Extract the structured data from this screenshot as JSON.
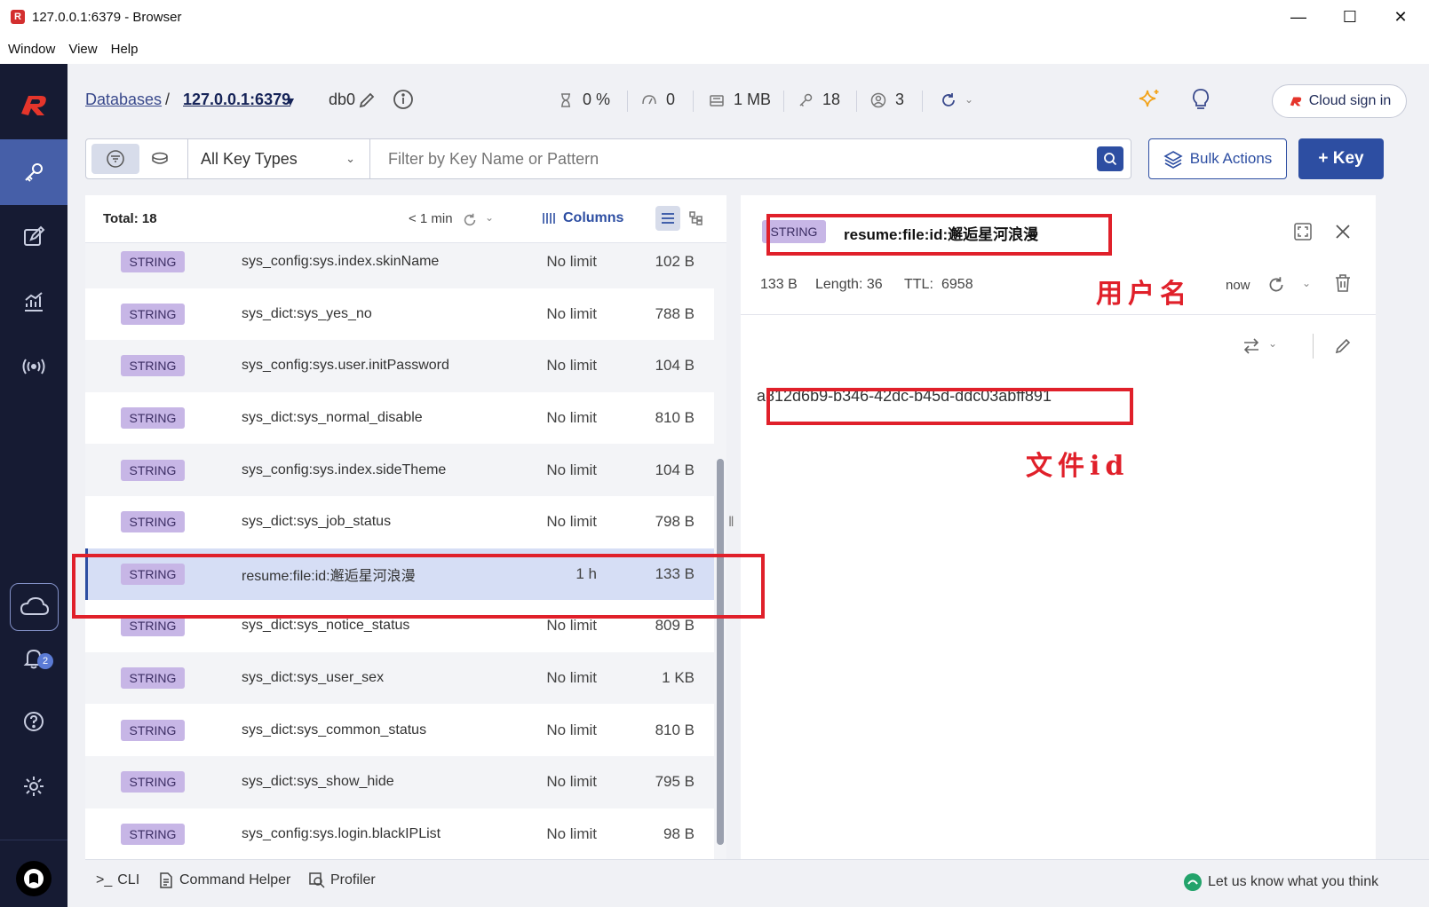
{
  "window": {
    "title": "127.0.0.1:6379 - Browser",
    "minimize": "—",
    "maximize": "☐",
    "close": "✕"
  },
  "menu": [
    "Window",
    "View",
    "Help"
  ],
  "header": {
    "breadcrumb_root": "Databases",
    "breadcrumb_sep": "/",
    "database": "127.0.0.1:6379",
    "db_index": "db0",
    "stats": {
      "cpu": "0 %",
      "ops": "0",
      "memory": "1 MB",
      "keys": "18",
      "clients": "3"
    },
    "cloud_signin": "Cloud sign in"
  },
  "filter": {
    "key_type": "All Key Types",
    "placeholder": "Filter by Key Name or Pattern",
    "bulk_actions": "Bulk Actions",
    "add_key": "+ Key"
  },
  "keylist": {
    "total": "Total: 18",
    "refresh_time": "< 1 min",
    "columns_label": "Columns",
    "rows": [
      {
        "type": "STRING",
        "name": "sys_config:sys.index.skinName",
        "ttl": "No limit",
        "size": "102 B"
      },
      {
        "type": "STRING",
        "name": "sys_dict:sys_yes_no",
        "ttl": "No limit",
        "size": "788 B"
      },
      {
        "type": "STRING",
        "name": "sys_config:sys.user.initPassword",
        "ttl": "No limit",
        "size": "104 B"
      },
      {
        "type": "STRING",
        "name": "sys_dict:sys_normal_disable",
        "ttl": "No limit",
        "size": "810 B"
      },
      {
        "type": "STRING",
        "name": "sys_config:sys.index.sideTheme",
        "ttl": "No limit",
        "size": "104 B"
      },
      {
        "type": "STRING",
        "name": "sys_dict:sys_job_status",
        "ttl": "No limit",
        "size": "798 B"
      },
      {
        "type": "STRING",
        "name": "resume:file:id:邂逅星河浪漫",
        "ttl": "1 h",
        "size": "133 B"
      },
      {
        "type": "STRING",
        "name": "sys_dict:sys_notice_status",
        "ttl": "No limit",
        "size": "809 B"
      },
      {
        "type": "STRING",
        "name": "sys_dict:sys_user_sex",
        "ttl": "No limit",
        "size": "1 KB"
      },
      {
        "type": "STRING",
        "name": "sys_dict:sys_common_status",
        "ttl": "No limit",
        "size": "810 B"
      },
      {
        "type": "STRING",
        "name": "sys_dict:sys_show_hide",
        "ttl": "No limit",
        "size": "795 B"
      },
      {
        "type": "STRING",
        "name": "sys_config:sys.login.blackIPList",
        "ttl": "No limit",
        "size": "98 B"
      }
    ]
  },
  "details": {
    "type": "STRING",
    "key": "resume:file:id:邂逅星河浪漫",
    "size": "133 B",
    "length": "Length: 36",
    "ttl_label": "TTL:",
    "ttl_value": "6958",
    "refreshed": "now",
    "value": "a812d6b9-b346-42dc-b45d-ddc03abff891"
  },
  "annotations": {
    "username": "用户名",
    "file_id": "文件id"
  },
  "nav": {
    "notifications_count": "2"
  },
  "bottombar": {
    "cli": "CLI",
    "command_helper": "Command Helper",
    "profiler": "Profiler",
    "feedback": "Let us know what you think"
  },
  "colors": {
    "accent": "#2d4ea2",
    "nav_bg": "#161b33",
    "badge_string": "#c7b6e6",
    "annotation_red": "#e0202a"
  }
}
